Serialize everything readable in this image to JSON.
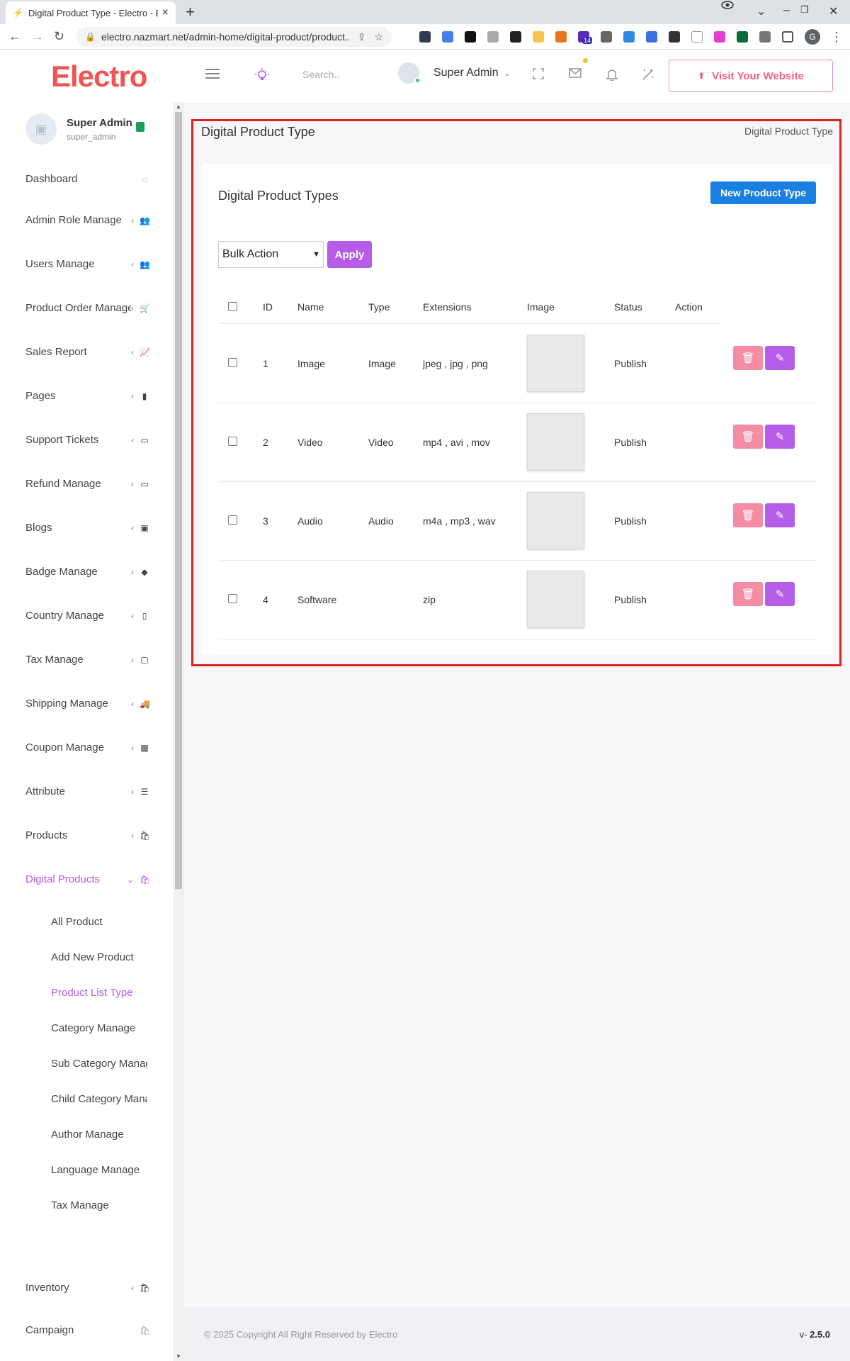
{
  "browser": {
    "tab_title": "Digital Product Type - Electro - E",
    "url": "electro.nazmart.net/admin-home/digital-product/product...",
    "profile_initial": "G",
    "extension_badge": "14"
  },
  "header": {
    "logo": "Electro",
    "search_placeholder": "Search..",
    "admin_name": "Super Admin",
    "visit_label": "Visit Your Website"
  },
  "sidebar": {
    "user_name": "Super Admin",
    "user_handle": "super_admin",
    "items": [
      {
        "label": "Dashboard"
      },
      {
        "label": "Admin Role Manage"
      },
      {
        "label": "Users Manage"
      },
      {
        "label": "Product Order Manage"
      },
      {
        "label": "Sales Report"
      },
      {
        "label": "Pages"
      },
      {
        "label": "Support Tickets"
      },
      {
        "label": "Refund Manage"
      },
      {
        "label": "Blogs"
      },
      {
        "label": "Badge Manage"
      },
      {
        "label": "Country Manage"
      },
      {
        "label": "Tax Manage"
      },
      {
        "label": "Shipping Manage"
      },
      {
        "label": "Coupon Manage"
      },
      {
        "label": "Attribute"
      },
      {
        "label": "Products"
      },
      {
        "label": "Digital Products"
      }
    ],
    "subitems": [
      {
        "label": "All Product"
      },
      {
        "label": "Add New Product"
      },
      {
        "label": "Product List Type"
      },
      {
        "label": "Category Manage"
      },
      {
        "label": "Sub Category Manage"
      },
      {
        "label": "Child Category Manage"
      },
      {
        "label": "Author Manage"
      },
      {
        "label": "Language Manage"
      },
      {
        "label": "Tax Manage"
      }
    ],
    "bottom_items": [
      {
        "label": "Inventory"
      },
      {
        "label": "Campaign"
      }
    ]
  },
  "page": {
    "title": "Digital Product Type",
    "breadcrumb": "Digital Product Type",
    "card_title": "Digital Product Types",
    "new_button": "New Product Type",
    "bulk_action": "Bulk Action",
    "apply": "Apply"
  },
  "table": {
    "headers": [
      "ID",
      "Name",
      "Type",
      "Extensions",
      "Image",
      "Status",
      "Action"
    ],
    "rows": [
      {
        "id": "1",
        "name": "Image",
        "type": "Image",
        "extensions": "jpeg , jpg , png",
        "status": "Publish"
      },
      {
        "id": "2",
        "name": "Video",
        "type": "Video",
        "extensions": "mp4 , avi , mov",
        "status": "Publish"
      },
      {
        "id": "3",
        "name": "Audio",
        "type": "Audio",
        "extensions": "m4a , mp3 , wav",
        "status": "Publish"
      },
      {
        "id": "4",
        "name": "Software",
        "type": "",
        "extensions": "zip",
        "status": "Publish"
      }
    ]
  },
  "footer": {
    "copyright": "© 2025 Copyright All Right Reserved by Electro",
    "version_prefix": "v- ",
    "version": "2.5.0"
  },
  "colors": {
    "brand": "#f05454",
    "accent_purple": "#b55ce8",
    "primary_blue": "#1a7fe0",
    "danger_pink": "#f48ca3",
    "highlight_red": "#e02020"
  }
}
